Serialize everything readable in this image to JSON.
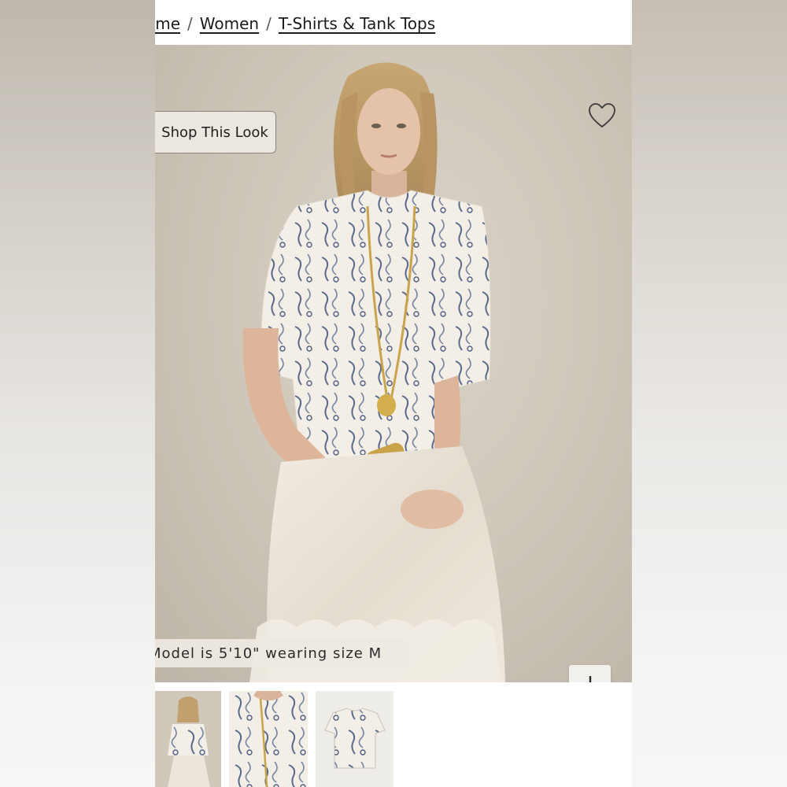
{
  "breadcrumb": {
    "items": [
      "Home",
      "Women",
      "T-Shirts & Tank Tops"
    ],
    "home_visible": "ome",
    "separator": "/"
  },
  "hero": {
    "shop_look_label": "Shop This Look",
    "model_note": "Model is 5'10\" wearing size M",
    "wishlist_icon": "heart-outline-icon",
    "expand_icon": "plus-icon"
  },
  "thumbnails": [
    {
      "name": "thumbnail-full-look"
    },
    {
      "name": "thumbnail-detail"
    },
    {
      "name": "thumbnail-flat-lay"
    }
  ],
  "colors": {
    "page_bg": "#ffffff",
    "text": "#1b1b1b",
    "hero_bg": "#cfc8bb"
  }
}
